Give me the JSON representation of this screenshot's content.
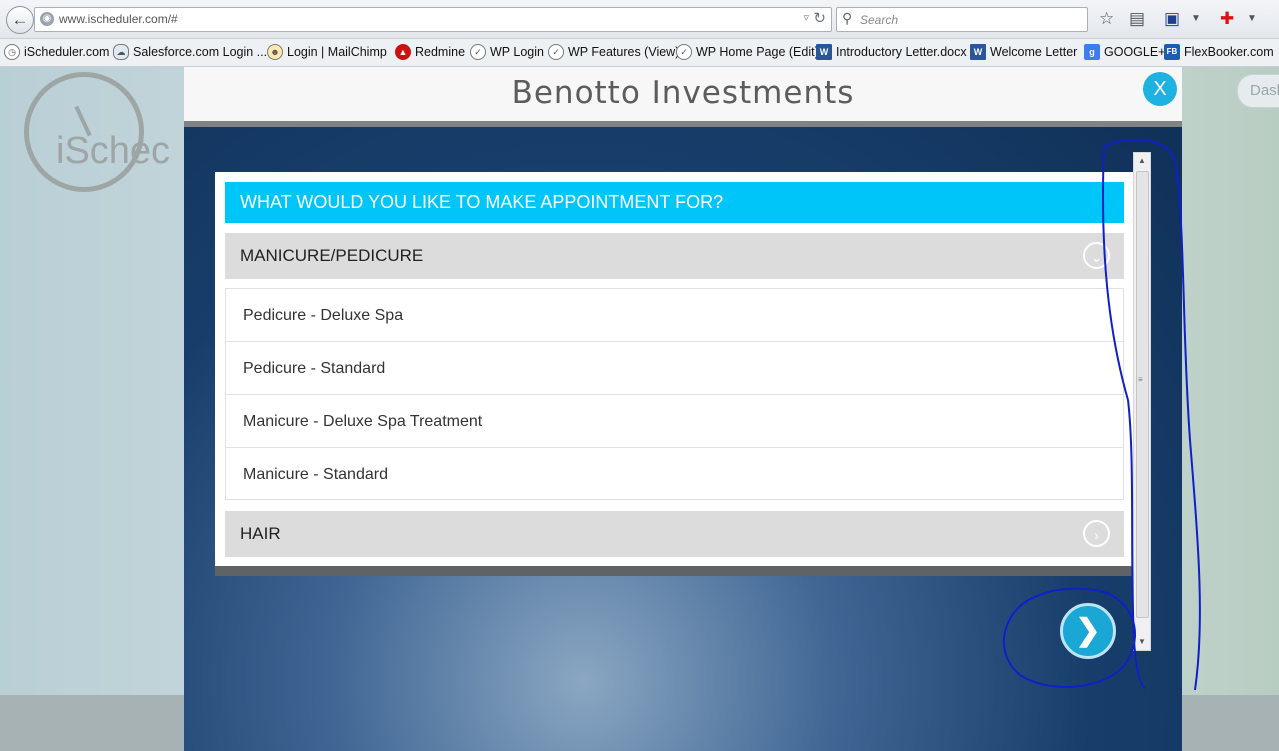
{
  "browser": {
    "url": "www.ischeduler.com/#",
    "search_placeholder": "Search",
    "bookmarks": [
      {
        "label": "iScheduler.com",
        "icon": "clock-icon"
      },
      {
        "label": "Salesforce.com Login ...",
        "icon": "cloud-icon"
      },
      {
        "label": "Login | MailChimp",
        "icon": "mailchimp-icon"
      },
      {
        "label": "Redmine",
        "icon": "redmine-icon"
      },
      {
        "label": "WP Login",
        "icon": "clock-icon"
      },
      {
        "label": "WP Features (View)",
        "icon": "clock-icon"
      },
      {
        "label": "WP Home Page (Edit)",
        "icon": "clock-icon"
      },
      {
        "label": "Introductory Letter.docx",
        "icon": "word-icon"
      },
      {
        "label": "Welcome Letter",
        "icon": "word-icon"
      },
      {
        "label": "GOOGLE+",
        "icon": "google-icon"
      },
      {
        "label": "FlexBooker.com",
        "icon": "flexbooker-icon"
      }
    ]
  },
  "background": {
    "logo_text": "iSchec",
    "dash_label": "Dash"
  },
  "modal": {
    "title": "Benotto Investments",
    "close_label": "X",
    "question": "WHAT WOULD YOU LIKE TO MAKE APPOINTMENT FOR?",
    "categories": [
      {
        "label": "MANICURE/PEDICURE",
        "expanded": true,
        "services": [
          "Pedicure - Deluxe Spa",
          "Pedicure - Standard",
          "Manicure - Deluxe Spa Treatment",
          "Manicure - Standard"
        ]
      },
      {
        "label": "HAIR",
        "expanded": false
      }
    ],
    "accent_color": "#00c5f8",
    "next_icon": "chevron-right-icon"
  }
}
